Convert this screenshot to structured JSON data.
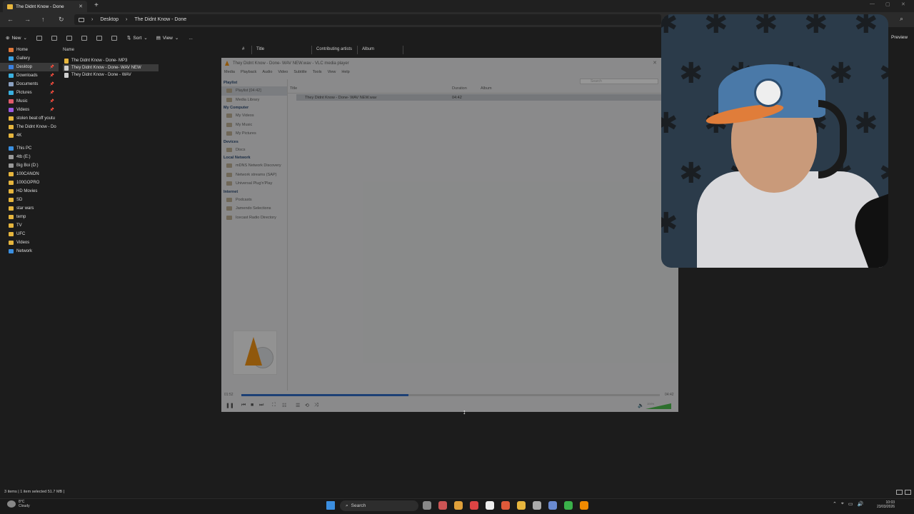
{
  "explorer": {
    "tab_title": "The Didnt Know - Done",
    "new_tab": "+",
    "breadcrumb": [
      "Desktop",
      "The Didnt Know - Done"
    ],
    "toolbar": {
      "new_label": "New",
      "sort_label": "Sort",
      "view_label": "View",
      "more_label": "...",
      "preview_label": "Preview"
    },
    "sidebar": {
      "quick": [
        {
          "label": "Home",
          "color": "#e0783a"
        },
        {
          "label": "Gallery",
          "color": "#3aa0e0"
        },
        {
          "label": "Desktop",
          "color": "#3a7fe0",
          "pinned": true,
          "selected": true
        },
        {
          "label": "Downloads",
          "color": "#3ab0e0",
          "pinned": true
        },
        {
          "label": "Documents",
          "color": "#8aa0c0",
          "pinned": true
        },
        {
          "label": "Pictures",
          "color": "#3ab0e0",
          "pinned": true
        },
        {
          "label": "Music",
          "color": "#e05a6a",
          "pinned": true
        },
        {
          "label": "Videos",
          "color": "#9a5ae0",
          "pinned": true
        },
        {
          "label": "stolen beat off youtu",
          "color": "#e6b53d"
        },
        {
          "label": "The Didnt Know - Do",
          "color": "#e6b53d"
        },
        {
          "label": "4K",
          "color": "#e6b53d"
        }
      ],
      "drives": [
        {
          "label": "This PC",
          "color": "#3a8fe0"
        },
        {
          "label": "4tb (E:)",
          "color": "#999"
        },
        {
          "label": "Big Boi (D:)",
          "color": "#999"
        },
        {
          "label": "100CANON",
          "color": "#e6b53d"
        },
        {
          "label": "100GOPRO",
          "color": "#e6b53d"
        },
        {
          "label": "HD Movies",
          "color": "#e6b53d"
        },
        {
          "label": "SD",
          "color": "#e6b53d"
        },
        {
          "label": "star wars",
          "color": "#e6b53d"
        },
        {
          "label": "temp",
          "color": "#e6b53d"
        },
        {
          "label": "TV",
          "color": "#e6b53d"
        },
        {
          "label": "UFC",
          "color": "#e6b53d"
        },
        {
          "label": "Videos",
          "color": "#e6b53d"
        },
        {
          "label": "Network",
          "color": "#3a8fe0"
        }
      ]
    },
    "columns": {
      "name": "Name",
      "num": "#",
      "title": "Title",
      "artists": "Contributing artists",
      "album": "Album"
    },
    "files": [
      {
        "name": "The Didnt Know - Done- MP3",
        "icon": "#e6b53d"
      },
      {
        "name": "They Didnt Know - Done- WAV NEW",
        "icon": "#cfcfcf",
        "selected": true
      },
      {
        "name": "They Didnt Know - Done - WAV",
        "icon": "#cfcfcf"
      }
    ],
    "status": "3 items  |  1 item selected  51.7 MB  |"
  },
  "vlc": {
    "title": "They Didnt Know - Done- WAV NEW.wav - VLC media player",
    "menu": [
      "Media",
      "Playback",
      "Audio",
      "Video",
      "Subtitle",
      "Tools",
      "View",
      "Help"
    ],
    "search_placeholder": "Search",
    "playlist_heading": "Playlist",
    "playlist_item": "Playlist [04:42]",
    "media_library": "Media Library",
    "my_computer": "My Computer",
    "my_computer_items": [
      "My Videos",
      "My Music",
      "My Pictures"
    ],
    "devices": "Devices",
    "devices_items": [
      "Discs"
    ],
    "local_network": "Local Network",
    "local_network_items": [
      "mDNS Network Discovery",
      "Network streams (SAP)",
      "Universal Plug'n'Play"
    ],
    "internet": "Internet",
    "internet_items": [
      "Podcasts",
      "Jamendo Selections",
      "Icecast Radio Directory"
    ],
    "col_title": "Title",
    "col_duration": "Duration",
    "col_album": "Album",
    "track": {
      "title": "They Didnt Know - Done- WAV NEW.wav",
      "duration": "04:42"
    },
    "elapsed": "01:52",
    "total": "04:42",
    "progress": 0.4,
    "volume_label": "100%"
  },
  "taskbar": {
    "weather_temp": "8°C",
    "weather_desc": "Cloudy",
    "search_label": "Search",
    "time": "10:03",
    "date": "23/03/2026",
    "apps": [
      {
        "name": "task-view-icon",
        "color": "#888"
      },
      {
        "name": "app-icon",
        "color": "#c55"
      },
      {
        "name": "chrome-icon",
        "color": "#e0a03a"
      },
      {
        "name": "browser-icon",
        "color": "#d44"
      },
      {
        "name": "tiktok-icon",
        "color": "#eee"
      },
      {
        "name": "brave-icon",
        "color": "#e05a3a"
      },
      {
        "name": "folder-icon",
        "color": "#e6b53d"
      },
      {
        "name": "app-icon-2",
        "color": "#aaa"
      },
      {
        "name": "globe-icon",
        "color": "#6a8ad0"
      },
      {
        "name": "chrome-icon-2",
        "color": "#3ab04a"
      },
      {
        "name": "vlc-icon",
        "color": "#f08a00"
      }
    ]
  }
}
